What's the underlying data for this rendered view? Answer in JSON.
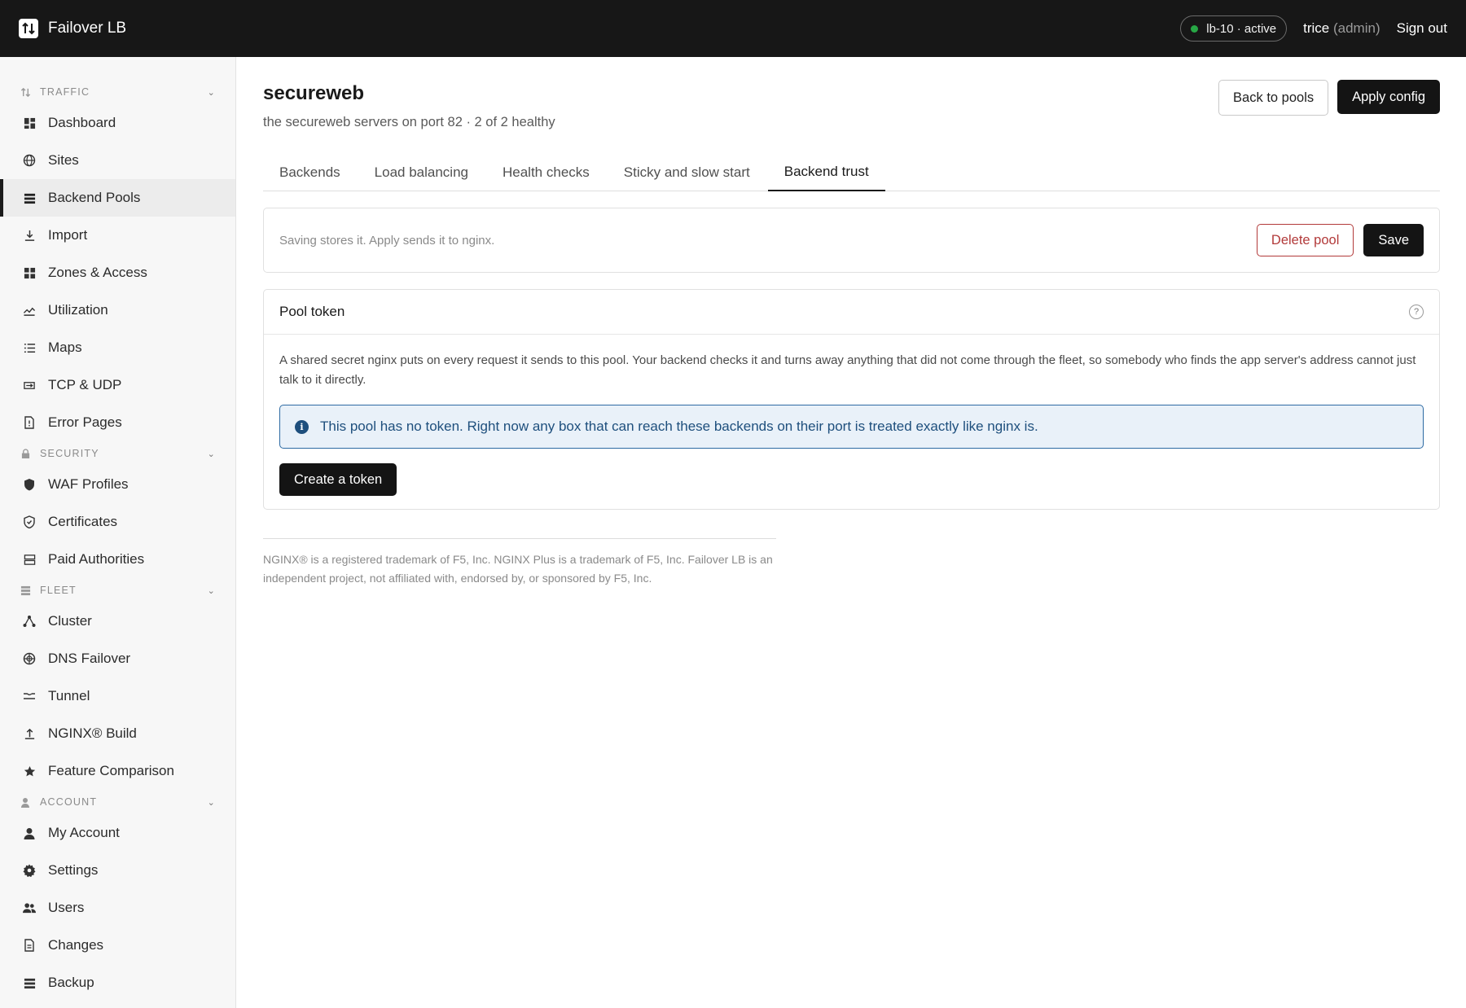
{
  "app": {
    "name": "Failover LB"
  },
  "topbar": {
    "node_status": "lb-10 · active",
    "user_name": "trice",
    "user_role": "(admin)",
    "sign_out": "Sign out",
    "status_color": "#27a745"
  },
  "sidebar": {
    "sections": [
      {
        "label": "TRAFFIC",
        "icon": "traffic-icon",
        "items": [
          {
            "label": "Dashboard",
            "icon": "dashboard-icon"
          },
          {
            "label": "Sites",
            "icon": "globe-icon"
          },
          {
            "label": "Backend Pools",
            "icon": "stack-icon",
            "active": true
          },
          {
            "label": "Import",
            "icon": "download-icon"
          },
          {
            "label": "Zones & Access",
            "icon": "grid-icon"
          },
          {
            "label": "Utilization",
            "icon": "chart-icon"
          },
          {
            "label": "Maps",
            "icon": "list-icon"
          },
          {
            "label": "TCP & UDP",
            "icon": "port-icon"
          },
          {
            "label": "Error Pages",
            "icon": "file-alert-icon"
          }
        ]
      },
      {
        "label": "SECURITY",
        "icon": "lock-icon",
        "items": [
          {
            "label": "WAF Profiles",
            "icon": "shield-icon"
          },
          {
            "label": "Certificates",
            "icon": "shield-check-icon"
          },
          {
            "label": "Paid Authorities",
            "icon": "server-icon"
          }
        ]
      },
      {
        "label": "FLEET",
        "icon": "fleet-icon",
        "items": [
          {
            "label": "Cluster",
            "icon": "cluster-icon"
          },
          {
            "label": "DNS Failover",
            "icon": "dns-globe-icon"
          },
          {
            "label": "Tunnel",
            "icon": "tunnel-icon"
          },
          {
            "label": "NGINX® Build",
            "icon": "upload-icon"
          },
          {
            "label": "Feature Comparison",
            "icon": "star-icon"
          }
        ]
      },
      {
        "label": "ACCOUNT",
        "icon": "person-icon",
        "items": [
          {
            "label": "My Account",
            "icon": "user-icon"
          },
          {
            "label": "Settings",
            "icon": "gear-icon"
          },
          {
            "label": "Users",
            "icon": "users-icon"
          },
          {
            "label": "Changes",
            "icon": "document-icon"
          },
          {
            "label": "Backup",
            "icon": "backup-icon"
          }
        ]
      }
    ]
  },
  "page": {
    "title": "secureweb",
    "subtitle": "the secureweb servers on port 82 · 2 of 2 healthy",
    "back_button": "Back to pools",
    "apply_button": "Apply config"
  },
  "tabs": [
    {
      "label": "Backends"
    },
    {
      "label": "Load balancing"
    },
    {
      "label": "Health checks"
    },
    {
      "label": "Sticky and slow start"
    },
    {
      "label": "Backend trust",
      "active": true
    }
  ],
  "savebar": {
    "hint": "Saving stores it. Apply sends it to nginx.",
    "delete_button": "Delete pool",
    "save_button": "Save"
  },
  "token_card": {
    "title": "Pool token",
    "help": "?",
    "description": "A shared secret nginx puts on every request it sends to this pool. Your backend checks it and turns away anything that did not come through the fleet, so somebody who finds the app server's address cannot just talk to it directly.",
    "alert": "This pool has no token. Right now any box that can reach these backends on their port is treated exactly like nginx is.",
    "create_button": "Create a token"
  },
  "footer": {
    "text": "NGINX® is a registered trademark of F5, Inc. NGINX Plus is a trademark of F5, Inc. Failover LB is an independent project, not affiliated with, endorsed by, or sponsored by F5, Inc."
  }
}
